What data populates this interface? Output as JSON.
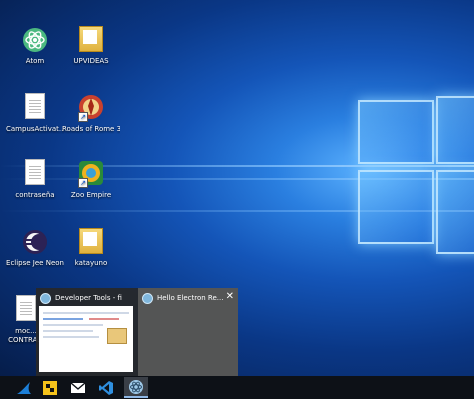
{
  "desktop_icons": [
    {
      "label": "Atom"
    },
    {
      "label": "UPVIDEAS"
    },
    {
      "label": "CampusActivat..."
    },
    {
      "label": "Roads of Rome 3"
    },
    {
      "label": "contraseña"
    },
    {
      "label": "Zoo Empire"
    },
    {
      "label": "Eclipse Jee Neon"
    },
    {
      "label": "katayuno"
    },
    {
      "label": "moc..."
    },
    {
      "label": "CONTRA..."
    }
  ],
  "preview": {
    "items": [
      {
        "title": "Developer Tools - file://..."
      },
      {
        "title": "Hello Electron Re..."
      }
    ],
    "close_glyph": "✕"
  },
  "taskbar": {
    "buttons": [
      {
        "icon": "shark-icon"
      },
      {
        "icon": "yellow-app-icon"
      },
      {
        "icon": "mail-icon"
      },
      {
        "icon": "vscode-icon"
      },
      {
        "icon": "electron-icon"
      }
    ]
  },
  "colors": {
    "wallpaper": "#1455b8",
    "taskbar": "#0d1117",
    "preview_bg": "#282828"
  }
}
